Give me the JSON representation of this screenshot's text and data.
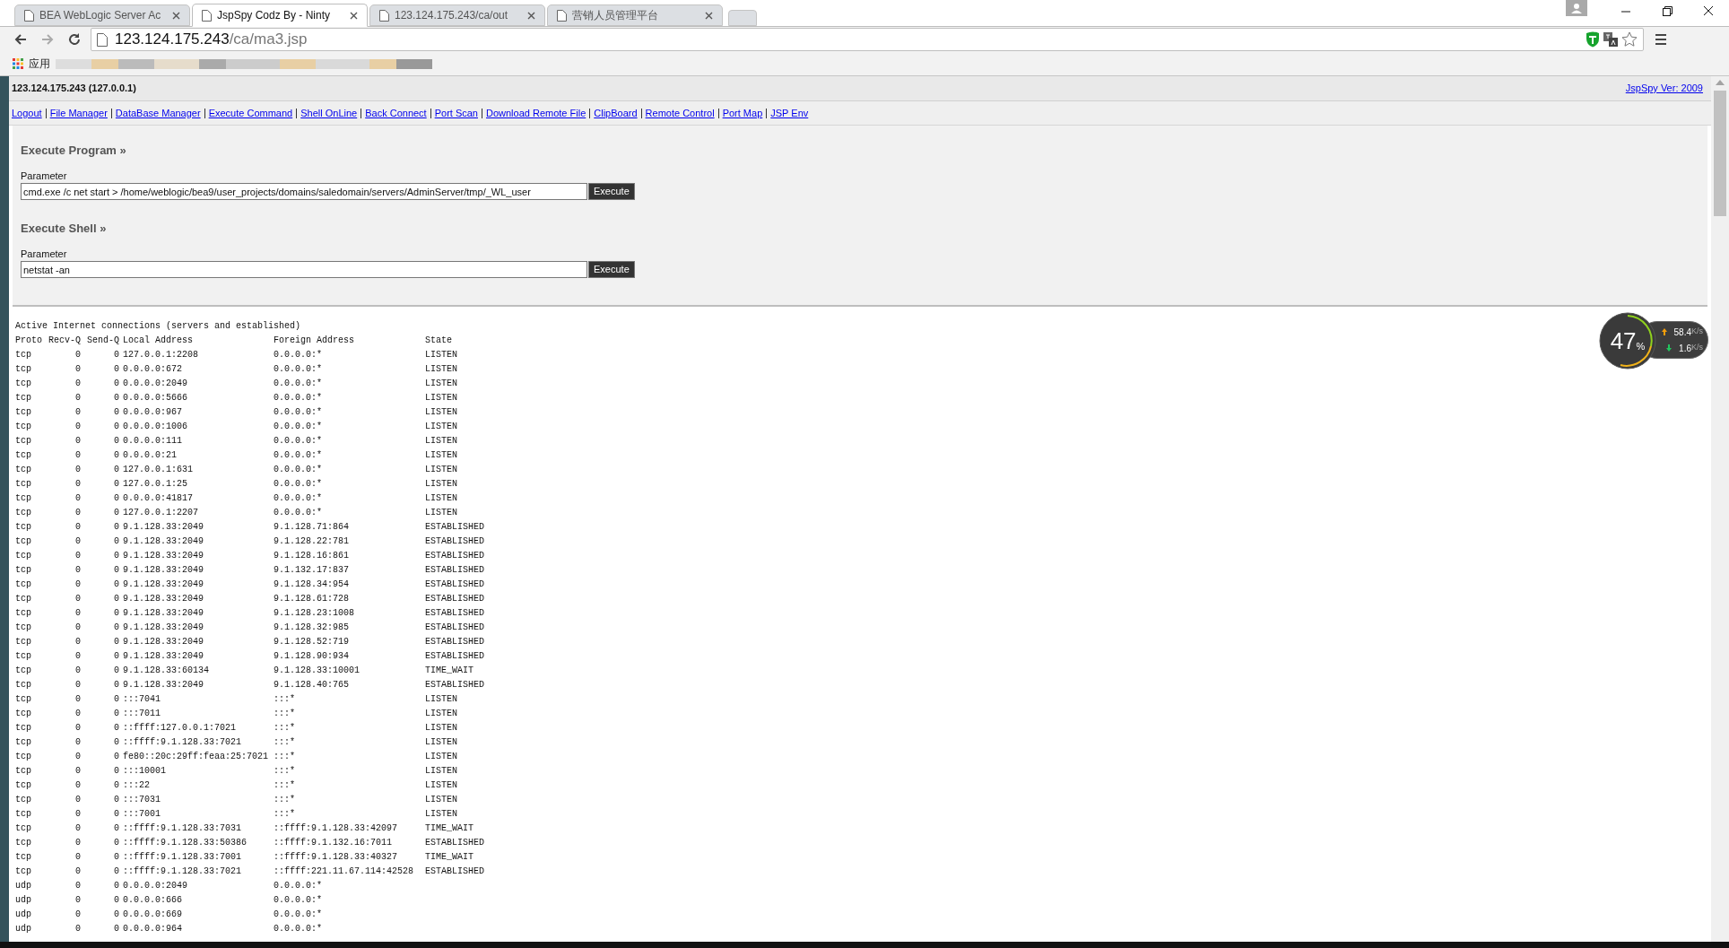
{
  "browser": {
    "tabs": [
      {
        "title": "BEA WebLogic Server Ac",
        "selected": false
      },
      {
        "title": "JspSpy Codz By - Ninty",
        "selected": true
      },
      {
        "title": "123.124.175.243/ca/out",
        "selected": false
      },
      {
        "title": "营销人员管理平台",
        "selected": false
      }
    ],
    "address": {
      "host": "123.124.175.243",
      "path": "/ca/ma3.jsp"
    },
    "bookmarks": {
      "apps_label": "应用"
    }
  },
  "page": {
    "host_info": "123.124.175.243 (127.0.0.1)",
    "version_link": "JspSpy Ver: 2009",
    "nav_links": [
      "Logout",
      "File Manager",
      "DataBase Manager",
      "Execute Command",
      "Shell OnLine",
      "Back Connect",
      "Port Scan",
      "Download Remote File",
      "ClipBoard",
      "Remote Control",
      "Port Map",
      "JSP Env"
    ],
    "sections": [
      {
        "title": "Execute Program »",
        "label": "Parameter",
        "value": "cmd.exe /c net start > /home/weblogic/bea9/user_projects/domains/saledomain/servers/AdminServer/tmp/_WL_user",
        "button": "Execute"
      },
      {
        "title": "Execute Shell »",
        "label": "Parameter",
        "value": "netstat -an",
        "button": "Execute"
      }
    ],
    "output": {
      "caption": "Active Internet connections (servers and established)",
      "columns": [
        "Proto",
        "Recv-Q",
        "Send-Q",
        "Local Address",
        "Foreign Address",
        "State"
      ],
      "rows": [
        [
          "tcp",
          "0",
          "0",
          "127.0.0.1:2208",
          "0.0.0.0:*",
          "LISTEN"
        ],
        [
          "tcp",
          "0",
          "0",
          "0.0.0.0:672",
          "0.0.0.0:*",
          "LISTEN"
        ],
        [
          "tcp",
          "0",
          "0",
          "0.0.0.0:2049",
          "0.0.0.0:*",
          "LISTEN"
        ],
        [
          "tcp",
          "0",
          "0",
          "0.0.0.0:5666",
          "0.0.0.0:*",
          "LISTEN"
        ],
        [
          "tcp",
          "0",
          "0",
          "0.0.0.0:967",
          "0.0.0.0:*",
          "LISTEN"
        ],
        [
          "tcp",
          "0",
          "0",
          "0.0.0.0:1006",
          "0.0.0.0:*",
          "LISTEN"
        ],
        [
          "tcp",
          "0",
          "0",
          "0.0.0.0:111",
          "0.0.0.0:*",
          "LISTEN"
        ],
        [
          "tcp",
          "0",
          "0",
          "0.0.0.0:21",
          "0.0.0.0:*",
          "LISTEN"
        ],
        [
          "tcp",
          "0",
          "0",
          "127.0.0.1:631",
          "0.0.0.0:*",
          "LISTEN"
        ],
        [
          "tcp",
          "0",
          "0",
          "127.0.0.1:25",
          "0.0.0.0:*",
          "LISTEN"
        ],
        [
          "tcp",
          "0",
          "0",
          "0.0.0.0:41817",
          "0.0.0.0:*",
          "LISTEN"
        ],
        [
          "tcp",
          "0",
          "0",
          "127.0.0.1:2207",
          "0.0.0.0:*",
          "LISTEN"
        ],
        [
          "tcp",
          "0",
          "0",
          "9.1.128.33:2049",
          "9.1.128.71:864",
          "ESTABLISHED"
        ],
        [
          "tcp",
          "0",
          "0",
          "9.1.128.33:2049",
          "9.1.128.22:781",
          "ESTABLISHED"
        ],
        [
          "tcp",
          "0",
          "0",
          "9.1.128.33:2049",
          "9.1.128.16:861",
          "ESTABLISHED"
        ],
        [
          "tcp",
          "0",
          "0",
          "9.1.128.33:2049",
          "9.1.132.17:837",
          "ESTABLISHED"
        ],
        [
          "tcp",
          "0",
          "0",
          "9.1.128.33:2049",
          "9.1.128.34:954",
          "ESTABLISHED"
        ],
        [
          "tcp",
          "0",
          "0",
          "9.1.128.33:2049",
          "9.1.128.61:728",
          "ESTABLISHED"
        ],
        [
          "tcp",
          "0",
          "0",
          "9.1.128.33:2049",
          "9.1.128.23:1008",
          "ESTABLISHED"
        ],
        [
          "tcp",
          "0",
          "0",
          "9.1.128.33:2049",
          "9.1.128.32:985",
          "ESTABLISHED"
        ],
        [
          "tcp",
          "0",
          "0",
          "9.1.128.33:2049",
          "9.1.128.52:719",
          "ESTABLISHED"
        ],
        [
          "tcp",
          "0",
          "0",
          "9.1.128.33:2049",
          "9.1.128.90:934",
          "ESTABLISHED"
        ],
        [
          "tcp",
          "0",
          "0",
          "9.1.128.33:60134",
          "9.1.128.33:10001",
          "TIME_WAIT"
        ],
        [
          "tcp",
          "0",
          "0",
          "9.1.128.33:2049",
          "9.1.128.40:765",
          "ESTABLISHED"
        ],
        [
          "tcp",
          "0",
          "0",
          ":::7041",
          ":::*",
          "LISTEN"
        ],
        [
          "tcp",
          "0",
          "0",
          ":::7011",
          ":::*",
          "LISTEN"
        ],
        [
          "tcp",
          "0",
          "0",
          "::ffff:127.0.0.1:7021",
          ":::*",
          "LISTEN"
        ],
        [
          "tcp",
          "0",
          "0",
          "::ffff:9.1.128.33:7021",
          ":::*",
          "LISTEN"
        ],
        [
          "tcp",
          "0",
          "0",
          "fe80::20c:29ff:feaa:25:7021",
          ":::*",
          "LISTEN"
        ],
        [
          "tcp",
          "0",
          "0",
          ":::10001",
          ":::*",
          "LISTEN"
        ],
        [
          "tcp",
          "0",
          "0",
          ":::22",
          ":::*",
          "LISTEN"
        ],
        [
          "tcp",
          "0",
          "0",
          ":::7031",
          ":::*",
          "LISTEN"
        ],
        [
          "tcp",
          "0",
          "0",
          ":::7001",
          ":::*",
          "LISTEN"
        ],
        [
          "tcp",
          "0",
          "0",
          "::ffff:9.1.128.33:7031",
          "::ffff:9.1.128.33:42097",
          "TIME_WAIT"
        ],
        [
          "tcp",
          "0",
          "0",
          "::ffff:9.1.128.33:50386",
          "::ffff:9.1.132.16:7011",
          "ESTABLISHED"
        ],
        [
          "tcp",
          "0",
          "0",
          "::ffff:9.1.128.33:7001",
          "::ffff:9.1.128.33:40327",
          "TIME_WAIT"
        ],
        [
          "tcp",
          "0",
          "0",
          "::ffff:9.1.128.33:7021",
          "::ffff:221.11.67.114:42528",
          "ESTABLISHED"
        ],
        [
          "udp",
          "0",
          "0",
          "0.0.0.0:2049",
          "0.0.0.0:*"
        ],
        [
          "udp",
          "0",
          "0",
          "0.0.0.0:666",
          "0.0.0.0:*"
        ],
        [
          "udp",
          "0",
          "0",
          "0.0.0.0:669",
          "0.0.0.0:*"
        ],
        [
          "udp",
          "0",
          "0",
          "0.0.0.0:964",
          "0.0.0.0:*"
        ]
      ]
    }
  },
  "speed_widget": {
    "percent": "47",
    "percent_sign": "%",
    "upload": "58.4",
    "upload_unit": "K/s",
    "download": "1.6",
    "download_unit": "K/s"
  }
}
